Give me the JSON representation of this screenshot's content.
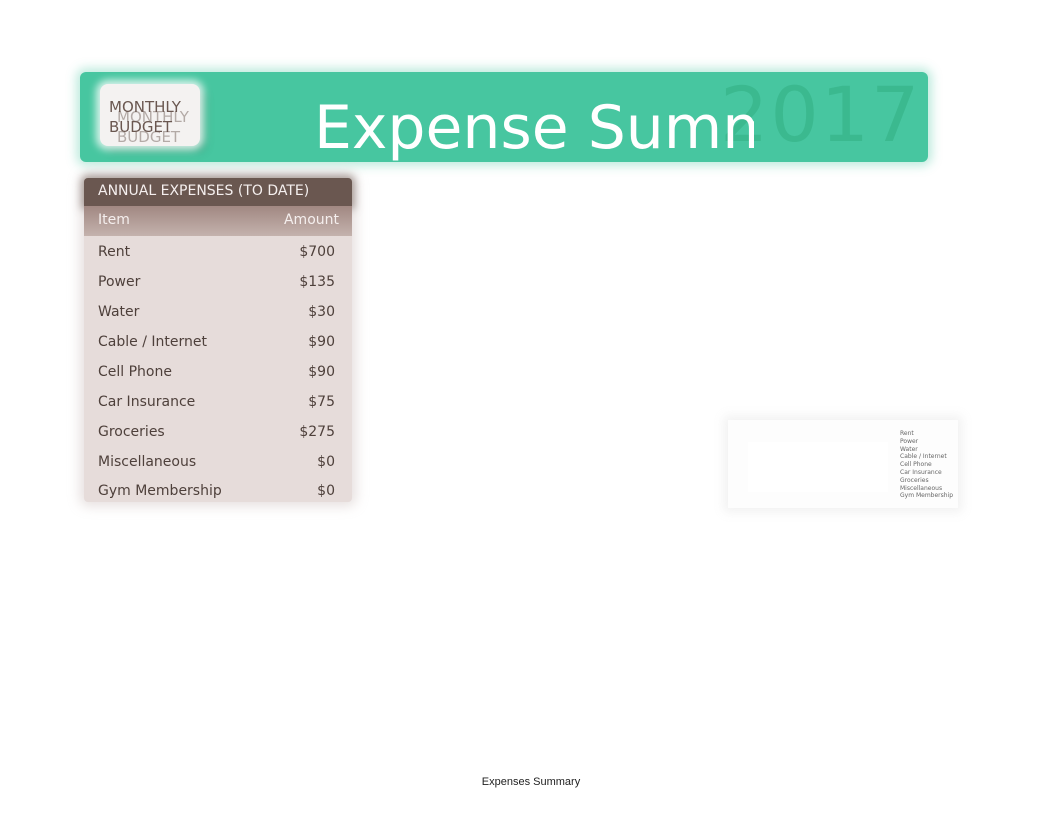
{
  "header": {
    "logo_line1": "MONTHLY",
    "logo_line2": "BUDGET",
    "title": "Expense Summary",
    "year": "2017"
  },
  "colors": {
    "banner": "#47c6a0",
    "table_header": "#6a5750",
    "table_body": "#e6dcda"
  },
  "table": {
    "title": "ANNUAL EXPENSES (TO DATE)",
    "columns": [
      "Item",
      "Amount"
    ],
    "rows": [
      {
        "item": "Rent",
        "amount": "$700"
      },
      {
        "item": "Power",
        "amount": "$135"
      },
      {
        "item": "Water",
        "amount": "$30"
      },
      {
        "item": "Cable / Internet",
        "amount": "$90"
      },
      {
        "item": "Cell Phone",
        "amount": "$90"
      },
      {
        "item": "Car Insurance",
        "amount": "$75"
      },
      {
        "item": "Groceries",
        "amount": "$275"
      },
      {
        "item": "Miscellaneous",
        "amount": "$0"
      },
      {
        "item": "Gym Membership",
        "amount": "$0"
      }
    ]
  },
  "chart_legend": [
    "Rent",
    "Power",
    "Water",
    "Cable / Internet",
    "Cell Phone",
    "Car Insurance",
    "Groceries",
    "Miscellaneous",
    "Gym Membership"
  ],
  "footer": {
    "sheet_name": "Expenses Summary"
  }
}
